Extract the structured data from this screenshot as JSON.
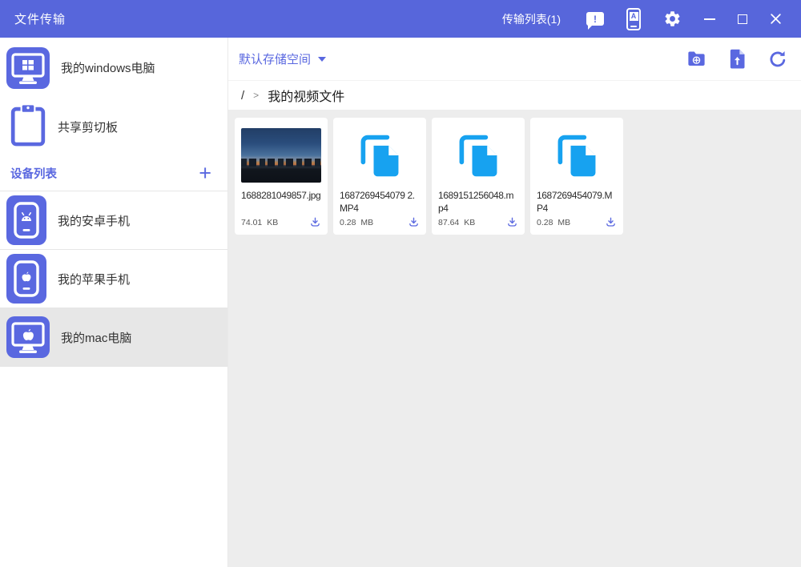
{
  "colors": {
    "titlebar": "#5766db",
    "accent": "#5a68e0",
    "file_icon_blue": "#17a2f0",
    "content_background": "#ededed",
    "selected_row": "#e7e7e7"
  },
  "titlebar": {
    "app_title": "文件传输",
    "transfer_list_label": "传输列表(1)",
    "feedback_mark": "!",
    "phone_icon_letter": "A",
    "icons": [
      "feedback-message-icon",
      "phone-connect-icon",
      "settings-gear-icon",
      "minimize-icon",
      "maximize-icon",
      "close-icon"
    ]
  },
  "sidebar": {
    "computer": {
      "label": "我的windows电脑",
      "icon": "windows-computer-icon"
    },
    "clipboard": {
      "label": "共享剪切板",
      "icon": "clipboard-icon"
    },
    "device_list": {
      "label": "设备列表",
      "add_label": "+"
    },
    "devices": [
      {
        "label": "我的安卓手机",
        "icon": "android-phone-icon",
        "selected": false
      },
      {
        "label": "我的苹果手机",
        "icon": "apple-phone-icon",
        "selected": false
      },
      {
        "label": "我的mac电脑",
        "icon": "mac-computer-icon",
        "selected": true
      }
    ]
  },
  "toolbar": {
    "storage_label": "默认存储空间",
    "icons": [
      "dropdown-caret-icon",
      "new-folder-icon",
      "upload-file-icon",
      "refresh-icon"
    ]
  },
  "breadcrumb": {
    "root": "/",
    "separator": ">",
    "current": "我的视频文件"
  },
  "files": [
    {
      "name": "1688281049857.jpg",
      "size": "74.01 KB",
      "type": "image"
    },
    {
      "name": "1687269454079 2.MP4",
      "size": "0.28 MB",
      "type": "file"
    },
    {
      "name": "1689151256048.mp4",
      "size": "87.64 KB",
      "type": "file"
    },
    {
      "name": "1687269454079.MP4",
      "size": "0.28 MB",
      "type": "file"
    }
  ]
}
